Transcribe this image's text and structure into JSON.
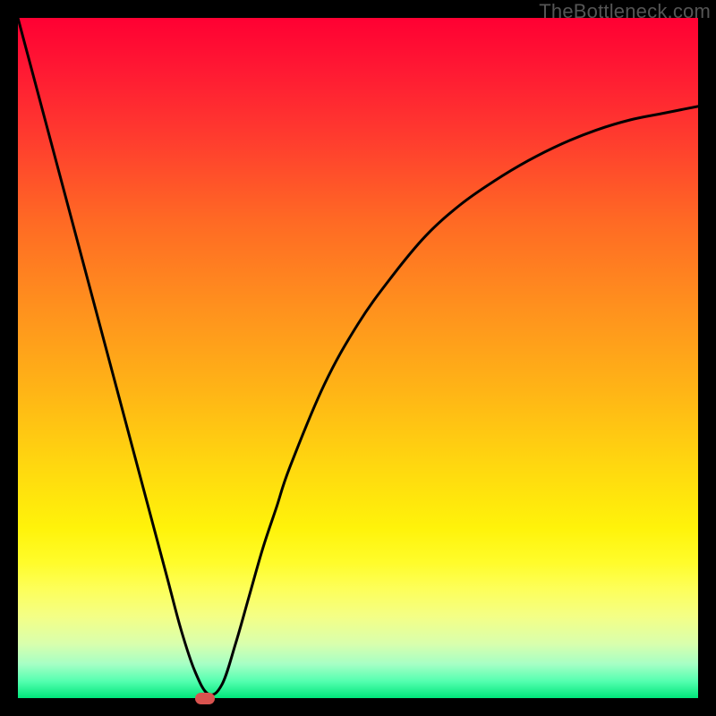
{
  "watermark": "TheBottleneck.com",
  "colors": {
    "frame": "#000000",
    "curve_stroke": "#000000",
    "marker_fill": "#d9534f",
    "gradient_top": "#ff0033",
    "gradient_bottom": "#00e67a"
  },
  "chart_data": {
    "type": "line",
    "title": "",
    "xlabel": "",
    "ylabel": "",
    "xlim": [
      0,
      100
    ],
    "ylim": [
      0,
      100
    ],
    "grid": false,
    "x": [
      0,
      2,
      4,
      6,
      8,
      10,
      12,
      14,
      16,
      18,
      20,
      22,
      24,
      26,
      28,
      30,
      32,
      34,
      36,
      38,
      40,
      45,
      50,
      55,
      60,
      65,
      70,
      75,
      80,
      85,
      90,
      95,
      100
    ],
    "y": [
      100,
      92.5,
      85,
      77.5,
      70,
      62.5,
      55,
      47.5,
      40,
      32.5,
      25,
      17.5,
      10,
      4,
      0.6,
      2,
      8,
      15,
      22,
      28,
      34,
      46,
      55,
      62,
      68,
      72.5,
      76,
      79,
      81.5,
      83.5,
      85,
      86,
      87
    ],
    "marker_point": {
      "x": 27.5,
      "y": 0
    },
    "note": "V-shaped bottleneck curve. x is an implicit horizontal parameter (0–100). y is bottleneck percentage (0 green, 100 red). Values estimated from pixel positions on a 760×760 plot area inside 20px black frame."
  },
  "layout": {
    "image_size": 800,
    "frame_border": 20,
    "plot_size": 760,
    "marker_style": {
      "rx": 7,
      "w": 22,
      "h": 13
    }
  }
}
